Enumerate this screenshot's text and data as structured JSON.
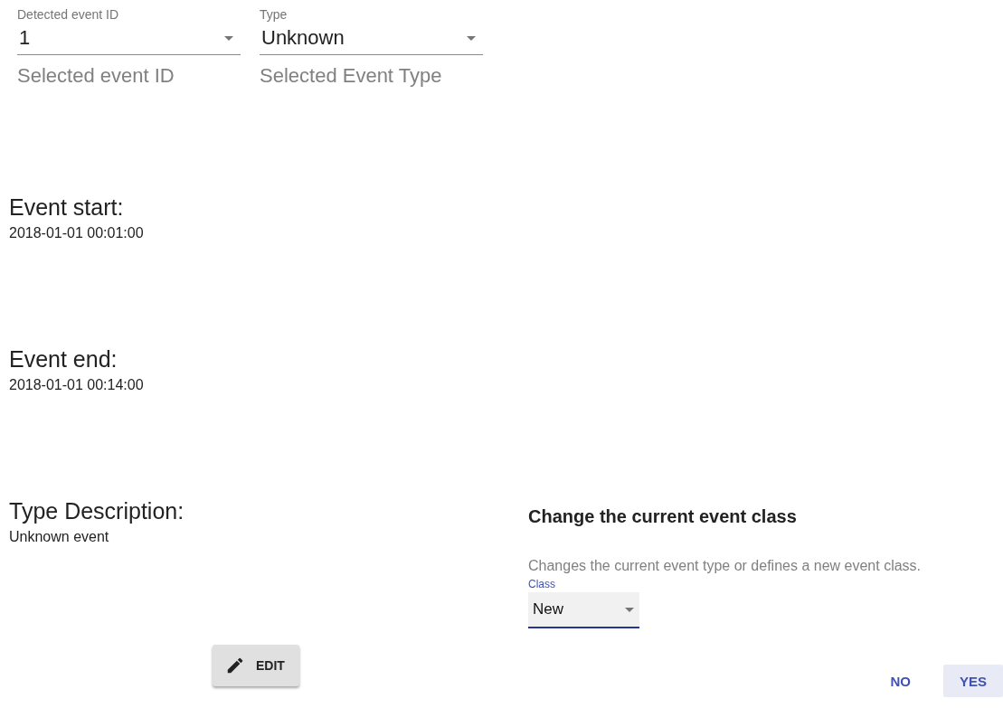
{
  "selects": [
    {
      "label": "Detected event ID",
      "value": "1",
      "helper": "Selected event ID"
    },
    {
      "label": "Type",
      "value": "Unknown",
      "helper": "Selected Event Type"
    }
  ],
  "details": [
    {
      "heading": "Event start:",
      "value": "2018-01-01 00:01:00"
    },
    {
      "heading": "Event end:",
      "value": "2018-01-01 00:14:00"
    },
    {
      "heading": "Type Description:",
      "value": "Unknown event"
    }
  ],
  "edit_button": "EDIT",
  "dialog": {
    "title": "Change the current event class",
    "text": "Changes the current event type or defines a new event class.",
    "field": {
      "label": "Class",
      "value": "New"
    },
    "buttons": [
      {
        "label": "NO",
        "focused": false
      },
      {
        "label": "YES",
        "focused": true
      }
    ]
  }
}
